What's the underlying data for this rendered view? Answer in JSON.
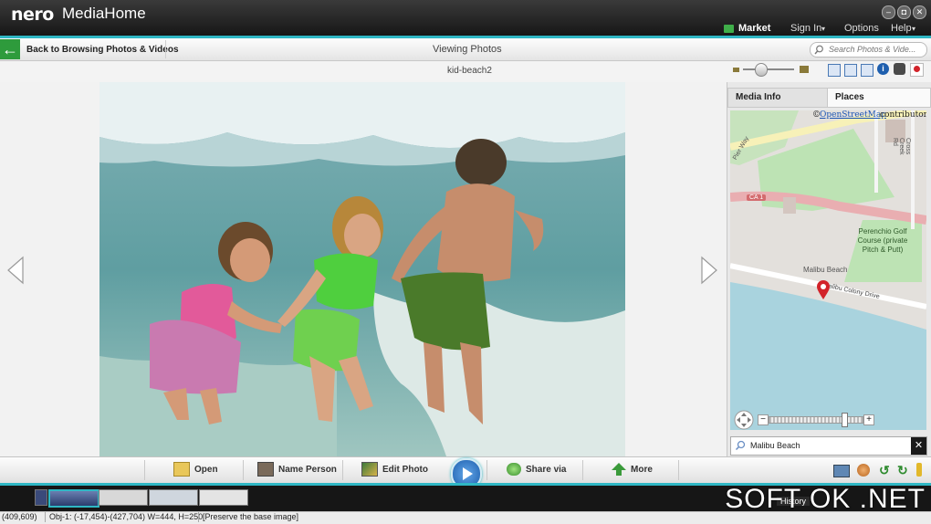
{
  "app": {
    "brand": "nero",
    "name": "MediaHome"
  },
  "menu": {
    "market": "Market",
    "sign_in": "Sign In",
    "options": "Options",
    "help": "Help"
  },
  "nav": {
    "back_label": "Back to Browsing Photos & Videos",
    "view_title": "Viewing Photos",
    "search_placeholder": "Search Photos & Vide..."
  },
  "photo": {
    "filename": "kid-beach2"
  },
  "panel": {
    "tabs": [
      "Media Info",
      "Places"
    ],
    "active_tab": "Places",
    "map": {
      "attribution_prefix": "©",
      "attribution_link": "OpenStreetMap",
      "attribution_suffix": "contributors",
      "labels": {
        "road_ca1": "CA 1",
        "golf_course": "Perenchio Golf Course (private Pitch & Putt)",
        "malibu_beach": "Malibu Beach",
        "colony_drive": "Malibu Colony Drive",
        "pier_way": "Pier Way",
        "cross_creek": "Cross Creek Rd"
      },
      "place_value": "Malibu Beach"
    }
  },
  "toolbar": {
    "open": "Open",
    "name_person": "Name Person",
    "edit_photo": "Edit Photo",
    "share_via": "Share via",
    "more": "More"
  },
  "filmstrip": {
    "history": "History"
  },
  "status": {
    "cursor": "(409,609)",
    "object": "Obj-1: (-17,454)-(427,704) W=444, H=250",
    "mode": "[Preserve the base image]"
  },
  "watermark": "SOFT OK .NET",
  "colors": {
    "accent": "#2fb7c4",
    "back_green": "#2e9b3c",
    "pin_red": "#d2232a",
    "map_green": "#bde3b4",
    "map_road": "#e9aeb1",
    "sea": "#a9d3de"
  }
}
